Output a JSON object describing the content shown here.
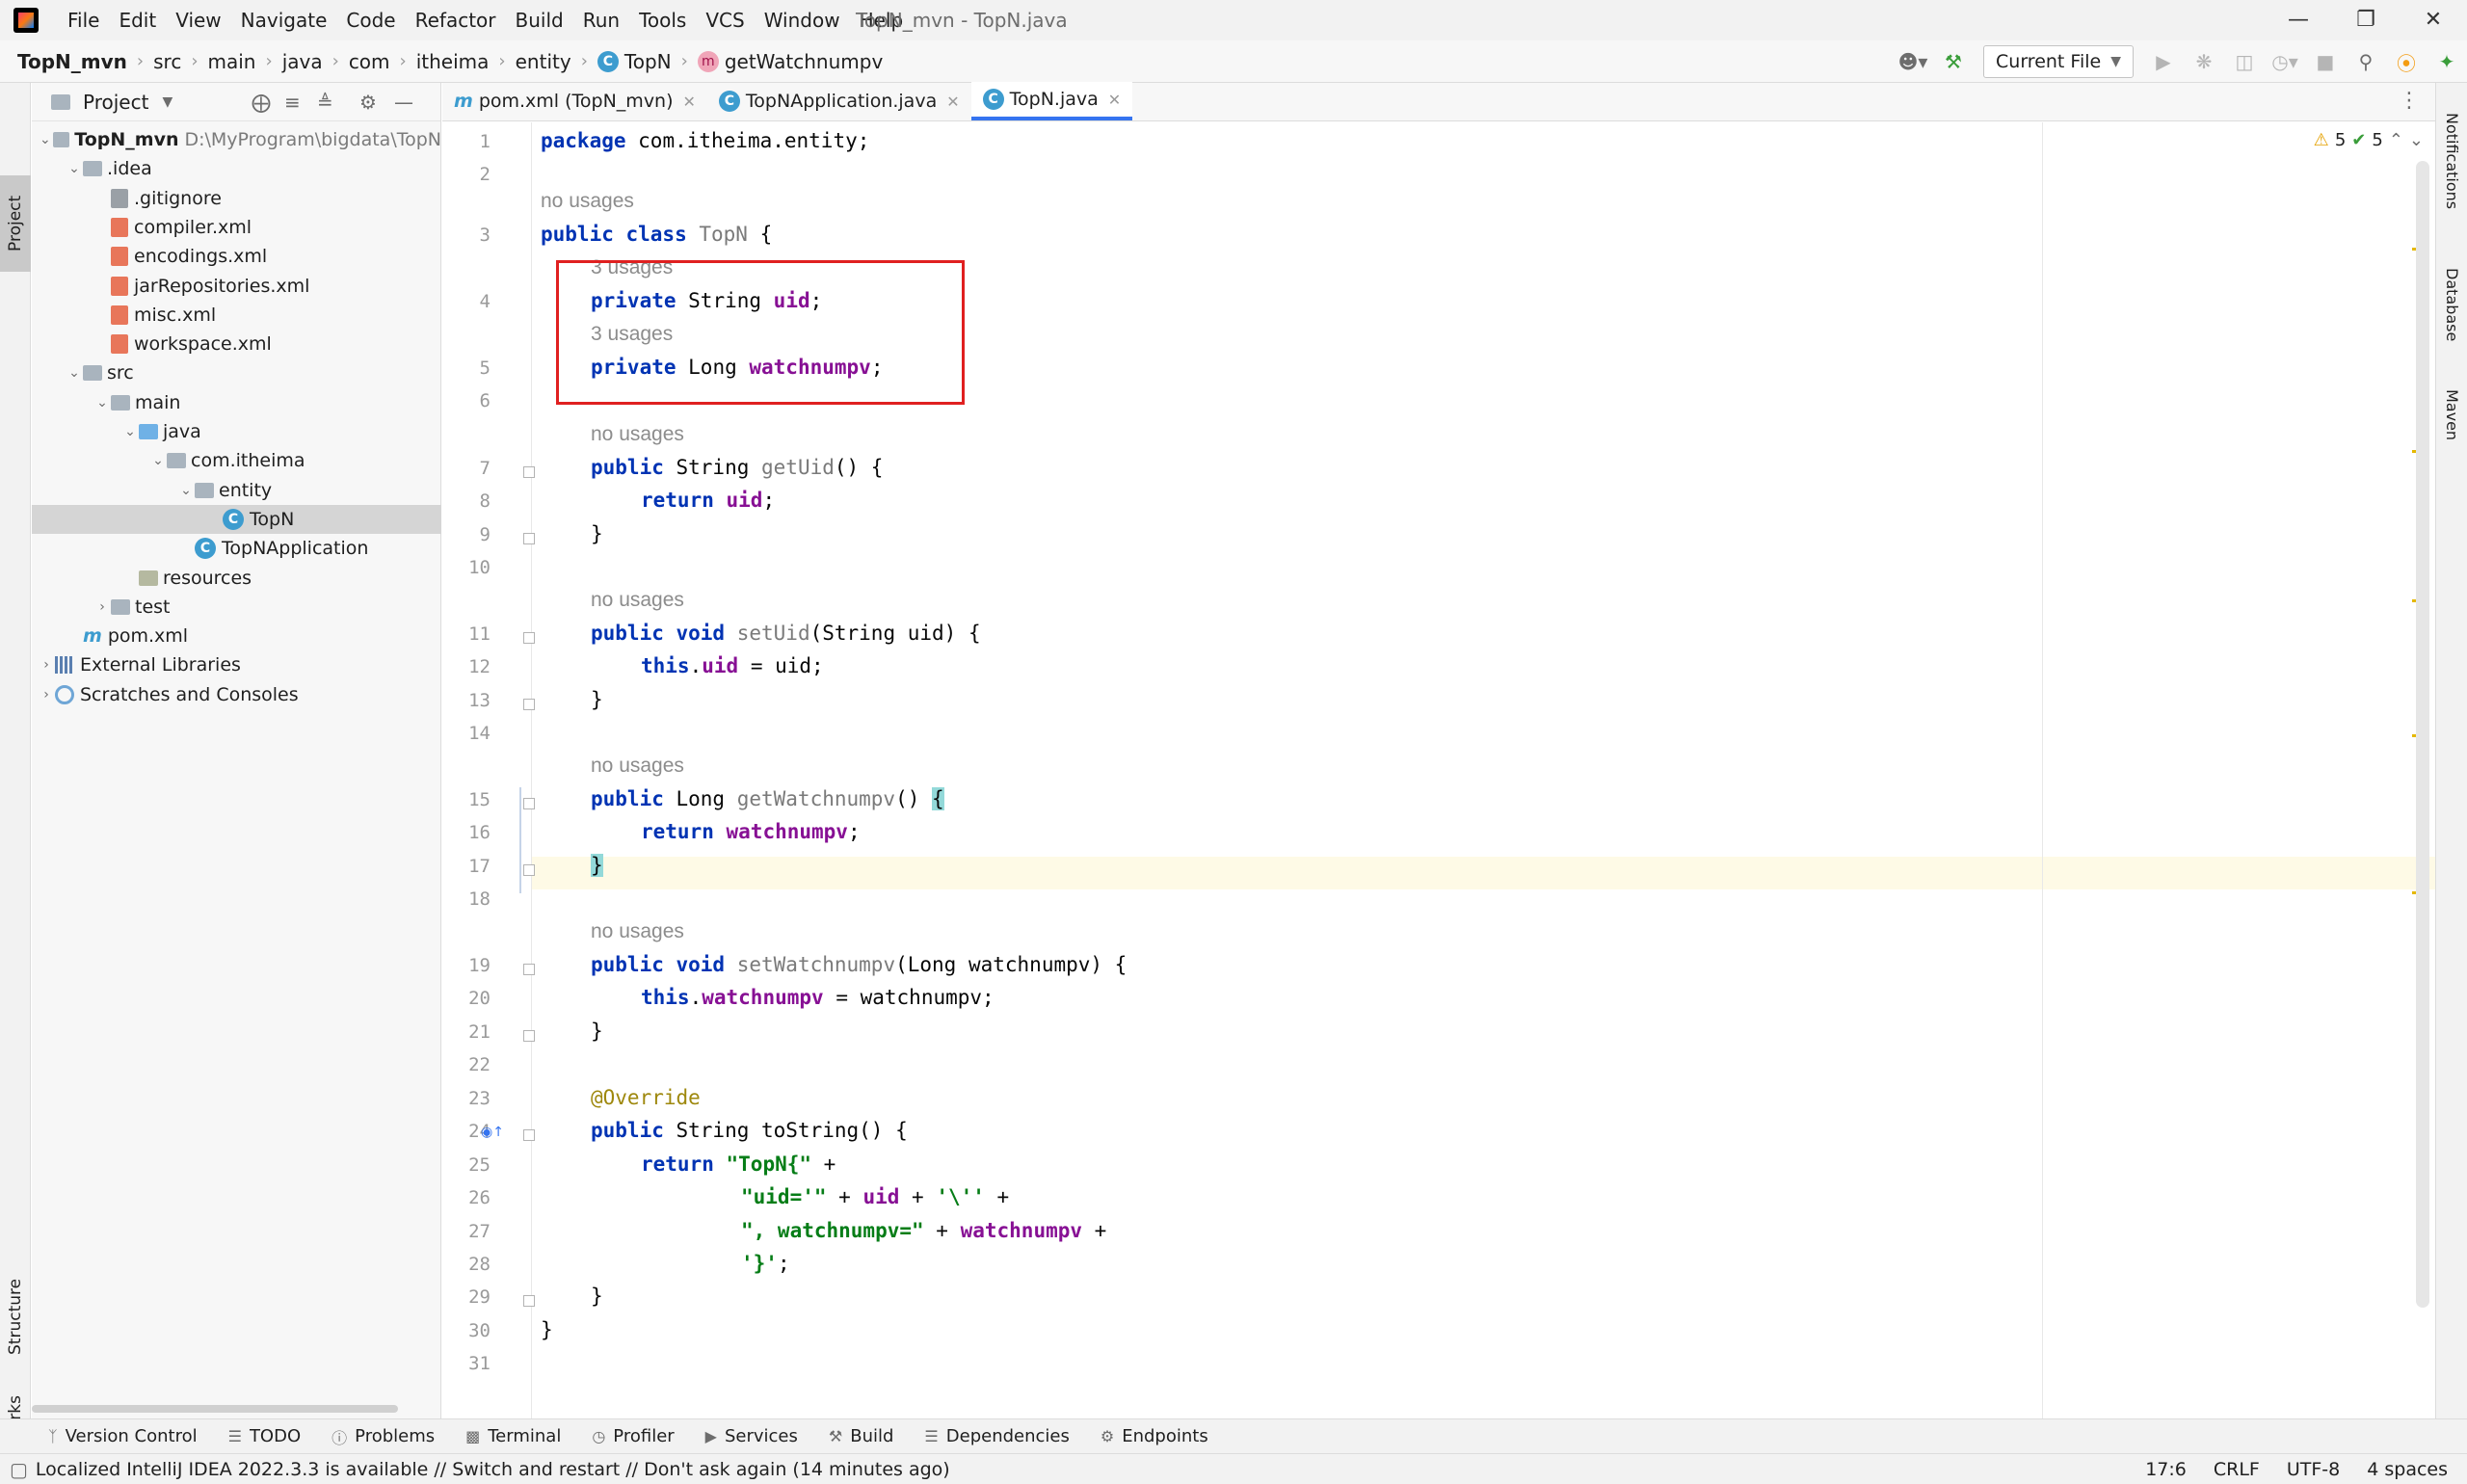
{
  "window": {
    "title": "TopN_mvn - TopN.java",
    "menu": [
      "File",
      "Edit",
      "View",
      "Navigate",
      "Code",
      "Refactor",
      "Build",
      "Run",
      "Tools",
      "VCS",
      "Window",
      "Help"
    ]
  },
  "breadcrumb": {
    "items": [
      "TopN_mvn",
      "src",
      "main",
      "java",
      "com",
      "itheima",
      "entity",
      "TopN",
      "getWatchnumpv"
    ]
  },
  "toolbar": {
    "run_config": "Current File"
  },
  "left_strip": {
    "project": "Project",
    "structure": "Structure",
    "bookmarks": "Bookmarks"
  },
  "project_panel": {
    "title": "Project",
    "tree": [
      {
        "label": "TopN_mvn",
        "extra": "D:\\MyProgram\\bigdata\\TopN",
        "depth": 0,
        "kind": "module",
        "expanded": true
      },
      {
        "label": ".idea",
        "depth": 1,
        "kind": "folder",
        "expanded": true
      },
      {
        "label": ".gitignore",
        "depth": 2,
        "kind": "file-gitignore"
      },
      {
        "label": "compiler.xml",
        "depth": 2,
        "kind": "file-xml"
      },
      {
        "label": "encodings.xml",
        "depth": 2,
        "kind": "file-xml"
      },
      {
        "label": "jarRepositories.xml",
        "depth": 2,
        "kind": "file-xml"
      },
      {
        "label": "misc.xml",
        "depth": 2,
        "kind": "file-xml"
      },
      {
        "label": "workspace.xml",
        "depth": 2,
        "kind": "file-xml"
      },
      {
        "label": "src",
        "depth": 1,
        "kind": "folder",
        "expanded": true
      },
      {
        "label": "main",
        "depth": 2,
        "kind": "folder",
        "expanded": true
      },
      {
        "label": "java",
        "depth": 3,
        "kind": "folder-source",
        "expanded": true
      },
      {
        "label": "com.itheima",
        "depth": 4,
        "kind": "package",
        "expanded": true
      },
      {
        "label": "entity",
        "depth": 5,
        "kind": "package",
        "expanded": true
      },
      {
        "label": "TopN",
        "depth": 6,
        "kind": "class",
        "selected": true
      },
      {
        "label": "TopNApplication",
        "depth": 5,
        "kind": "class-app"
      },
      {
        "label": "resources",
        "depth": 3,
        "kind": "folder-resources"
      },
      {
        "label": "test",
        "depth": 2,
        "kind": "folder",
        "expanded": false
      },
      {
        "label": "pom.xml",
        "depth": 1,
        "kind": "file-maven"
      },
      {
        "label": "External Libraries",
        "depth": 0,
        "kind": "libraries",
        "expanded": false
      },
      {
        "label": "Scratches and Consoles",
        "depth": 0,
        "kind": "scratches",
        "expanded": false
      }
    ]
  },
  "editor_tabs": [
    {
      "label": "pom.xml (TopN_mvn)",
      "kind": "maven",
      "active": false
    },
    {
      "label": "TopNApplication.java",
      "kind": "class-app",
      "active": false
    },
    {
      "label": "TopN.java",
      "kind": "class",
      "active": true
    }
  ],
  "inspection": {
    "warnings": "5",
    "weak_warnings": "5"
  },
  "editor": {
    "line_numbers": [
      "1",
      "2",
      "3",
      "4",
      "5",
      "6",
      "7",
      "8",
      "9",
      "10",
      "11",
      "12",
      "13",
      "14",
      "15",
      "16",
      "17",
      "18",
      "19",
      "20",
      "21",
      "22",
      "23",
      "24",
      "25",
      "26",
      "27",
      "28",
      "29",
      "30",
      "31"
    ],
    "hints": {
      "class": "no usages",
      "uid": "3 usages",
      "watchnumpv": "3 usages",
      "getUid": "no usages",
      "setUid": "no usages",
      "getWatchnumpv": "no usages",
      "setWatchnumpv": "no usages"
    }
  },
  "right_strip": {
    "notifications": "Notifications",
    "database": "Database",
    "maven": "Maven"
  },
  "bottom_tools": [
    "Version Control",
    "TODO",
    "Problems",
    "Terminal",
    "Profiler",
    "Services",
    "Build",
    "Dependencies",
    "Endpoints"
  ],
  "statusbar": {
    "message": "Localized IntelliJ IDEA 2022.3.3 is available // Switch and restart // Don't ask again (14 minutes ago)",
    "position": "17:6",
    "line_sep": "CRLF",
    "encoding": "UTF-8",
    "indent": "4 spaces"
  }
}
